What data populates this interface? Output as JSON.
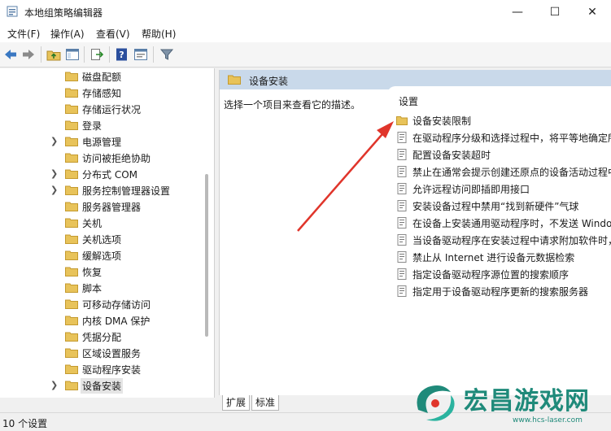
{
  "window": {
    "title": "本地组策略编辑器",
    "minimize": "—",
    "maximize": "☐",
    "close": "✕"
  },
  "menu": [
    "文件(F)",
    "操作(A)",
    "查看(V)",
    "帮助(H)"
  ],
  "toolbar": [
    "back-arrow-icon",
    "forward-arrow-icon",
    "up-folder-icon",
    "show-hide-tree-icon",
    "export-list-icon",
    "help-icon",
    "properties-icon",
    "filter-icon"
  ],
  "tree": [
    {
      "label": "磁盘配额",
      "expandable": false
    },
    {
      "label": "存储感知",
      "expandable": false
    },
    {
      "label": "存储运行状况",
      "expandable": false
    },
    {
      "label": "登录",
      "expandable": false
    },
    {
      "label": "电源管理",
      "expandable": true
    },
    {
      "label": "访问被拒绝协助",
      "expandable": false
    },
    {
      "label": "分布式 COM",
      "expandable": true
    },
    {
      "label": "服务控制管理器设置",
      "expandable": true
    },
    {
      "label": "服务器管理器",
      "expandable": false
    },
    {
      "label": "关机",
      "expandable": false
    },
    {
      "label": "关机选项",
      "expandable": false
    },
    {
      "label": "缓解选项",
      "expandable": false
    },
    {
      "label": "恢复",
      "expandable": false
    },
    {
      "label": "脚本",
      "expandable": false
    },
    {
      "label": "可移动存储访问",
      "expandable": false
    },
    {
      "label": "内核 DMA 保护",
      "expandable": false
    },
    {
      "label": "凭据分配",
      "expandable": false
    },
    {
      "label": "区域设置服务",
      "expandable": false
    },
    {
      "label": "驱动程序安装",
      "expandable": false
    },
    {
      "label": "设备安装",
      "expandable": true,
      "selected": true
    }
  ],
  "right": {
    "header_title": "设备安装",
    "description": "选择一个项目来查看它的描述。",
    "column_header": "设置",
    "items": [
      {
        "label": "设备安装限制",
        "type": "folder"
      },
      {
        "label": "在驱动程序分级和选择过程中，将平等地确定所",
        "type": "setting"
      },
      {
        "label": "配置设备安装超时",
        "type": "setting"
      },
      {
        "label": "禁止在通常会提示创建还原点的设备活动过程中",
        "type": "setting"
      },
      {
        "label": "允许远程访问即插即用接口",
        "type": "setting"
      },
      {
        "label": "安装设备过程中禁用“找到新硬件”气球",
        "type": "setting"
      },
      {
        "label": "在设备上安装通用驱动程序时，不发送 Windows",
        "type": "setting"
      },
      {
        "label": "当设备驱动程序在安装过程中请求附加软件时，",
        "type": "setting"
      },
      {
        "label": "禁止从 Internet 进行设备元数据检索",
        "type": "setting"
      },
      {
        "label": "指定设备驱动程序源位置的搜索顺序",
        "type": "setting"
      },
      {
        "label": "指定用于设备驱动程序更新的搜索服务器",
        "type": "setting"
      }
    ]
  },
  "tabs": [
    "扩展",
    "标准"
  ],
  "status": "10 个设置",
  "watermark": {
    "text": "宏昌游戏网",
    "url": "www.hcs-laser.com"
  },
  "colors": {
    "header_bg": "#c9d9ea",
    "folder": "#e8c35a",
    "arrow": "#e0352b",
    "watermark": "#1f8a7a"
  }
}
